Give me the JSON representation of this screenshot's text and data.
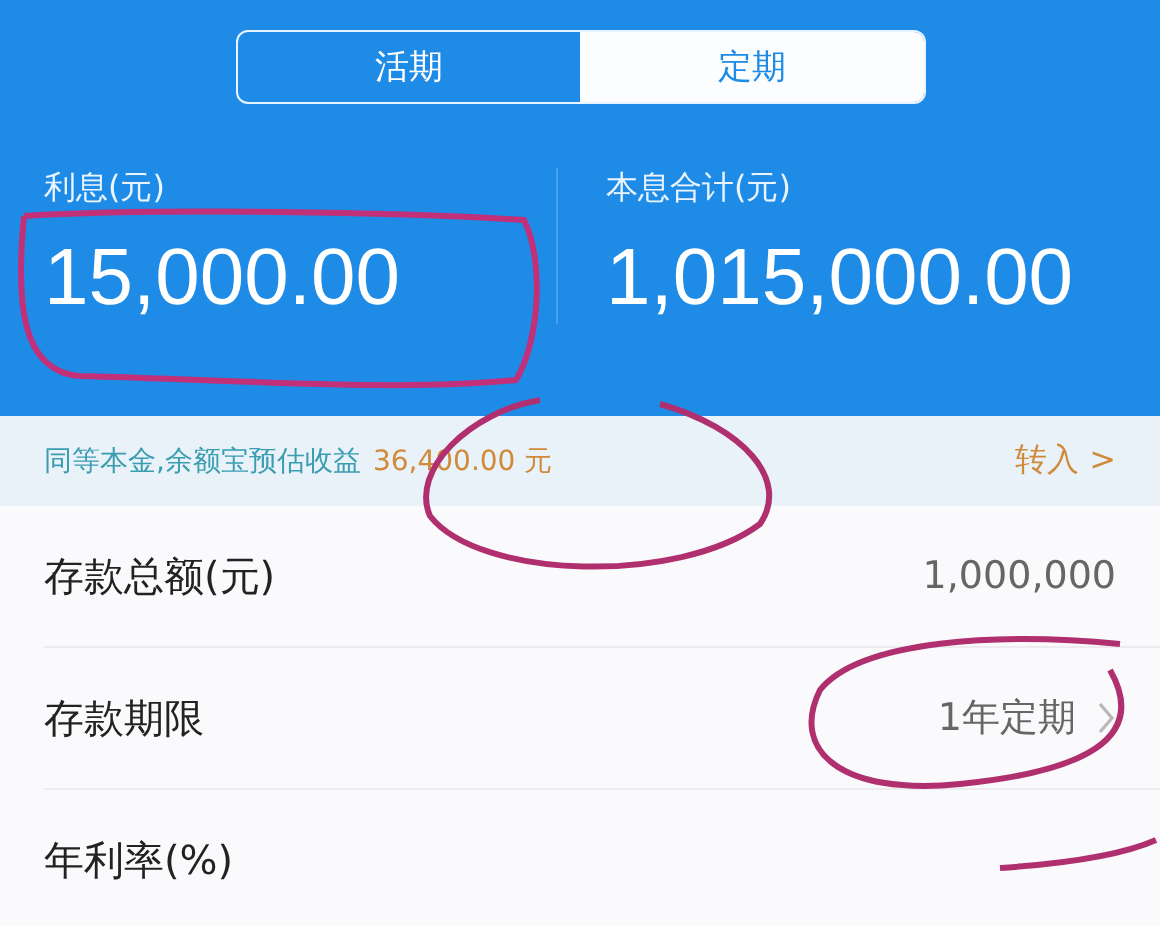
{
  "tabs": [
    {
      "label": "活期",
      "selected": false
    },
    {
      "label": "定期",
      "selected": true
    }
  ],
  "summary": [
    {
      "label": "利息(元)",
      "value": "15,000.00"
    },
    {
      "label": "本息合计(元)",
      "value": "1,015,000.00"
    }
  ],
  "banner": {
    "text": "同等本金,余额宝预估收益",
    "amount": "36,400.00 元",
    "action": "转入 >"
  },
  "rows": [
    {
      "kind": "value",
      "label": "存款总额(元)",
      "value": "1,000,000"
    },
    {
      "kind": "link",
      "label": "存款期限",
      "value": "1年定期"
    },
    {
      "kind": "value",
      "label": "年利率(%)"
    }
  ]
}
